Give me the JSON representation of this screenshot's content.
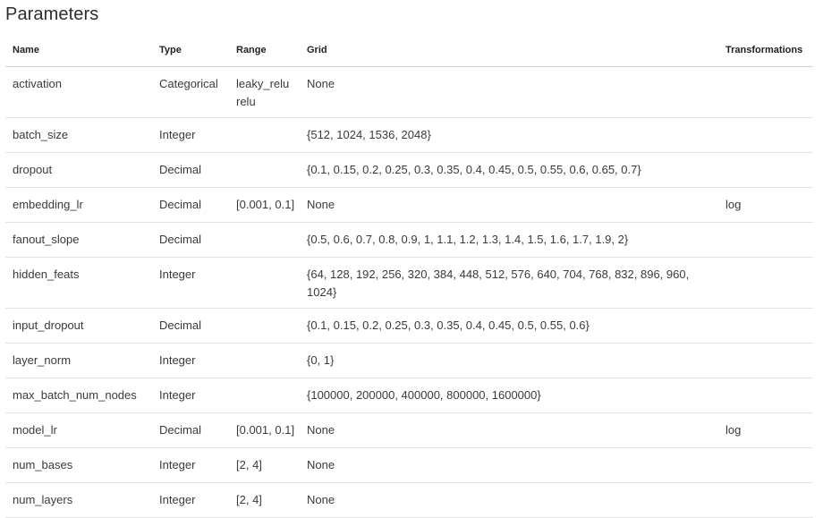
{
  "page": {
    "title": "Parameters"
  },
  "table": {
    "headers": {
      "name": "Name",
      "type": "Type",
      "range": "Range",
      "grid": "Grid",
      "transformations": "Transformations"
    },
    "rows": [
      {
        "name": "activation",
        "type": "Categorical",
        "range": [
          "leaky_relu",
          "relu"
        ],
        "grid": "None",
        "transformations": ""
      },
      {
        "name": "batch_size",
        "type": "Integer",
        "range": [],
        "grid": "{512, 1024, 1536, 2048}",
        "transformations": ""
      },
      {
        "name": "dropout",
        "type": "Decimal",
        "range": [],
        "grid": "{0.1, 0.15, 0.2, 0.25, 0.3, 0.35, 0.4, 0.45, 0.5, 0.55, 0.6, 0.65, 0.7}",
        "transformations": ""
      },
      {
        "name": "embedding_lr",
        "type": "Decimal",
        "range": [
          "[0.001, 0.1]"
        ],
        "grid": "None",
        "transformations": "log"
      },
      {
        "name": "fanout_slope",
        "type": "Decimal",
        "range": [],
        "grid": "{0.5, 0.6, 0.7, 0.8, 0.9, 1, 1.1, 1.2, 1.3, 1.4, 1.5, 1.6, 1.7, 1.9, 2}",
        "transformations": ""
      },
      {
        "name": "hidden_feats",
        "type": "Integer",
        "range": [],
        "grid": "{64, 128, 192, 256, 320, 384, 448, 512, 576, 640, 704, 768, 832, 896, 960, 1024}",
        "transformations": ""
      },
      {
        "name": "input_dropout",
        "type": "Decimal",
        "range": [],
        "grid": "{0.1, 0.15, 0.2, 0.25, 0.3, 0.35, 0.4, 0.45, 0.5, 0.55, 0.6}",
        "transformations": ""
      },
      {
        "name": "layer_norm",
        "type": "Integer",
        "range": [],
        "grid": "{0, 1}",
        "transformations": ""
      },
      {
        "name": "max_batch_num_nodes",
        "type": "Integer",
        "range": [],
        "grid": "{100000, 200000, 400000, 800000, 1600000}",
        "transformations": ""
      },
      {
        "name": "model_lr",
        "type": "Decimal",
        "range": [
          "[0.001, 0.1]"
        ],
        "grid": "None",
        "transformations": "log"
      },
      {
        "name": "num_bases",
        "type": "Integer",
        "range": [
          "[2, 4]"
        ],
        "grid": "None",
        "transformations": ""
      },
      {
        "name": "num_layers",
        "type": "Integer",
        "range": [
          "[2, 4]"
        ],
        "grid": "None",
        "transformations": ""
      }
    ]
  }
}
